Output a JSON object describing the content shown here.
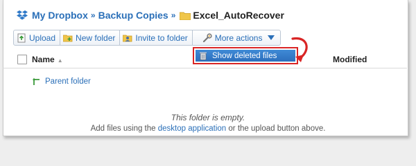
{
  "breadcrumb": {
    "root": "My Dropbox",
    "separator": "»",
    "parent": "Backup Copies",
    "current": "Excel_AutoRecover"
  },
  "toolbar": {
    "upload": "Upload",
    "new_folder": "New folder",
    "invite": "Invite to folder",
    "more_actions": "More actions"
  },
  "dropdown": {
    "show_deleted": "Show deleted files"
  },
  "table": {
    "col_name": "Name",
    "col_modified": "Modified",
    "parent_folder": "Parent folder"
  },
  "empty": {
    "title": "This folder is empty.",
    "sub_before": "Add files using the ",
    "sub_link": "desktop application",
    "sub_after": " or the upload button above."
  },
  "colors": {
    "link": "#2a6fb8",
    "highlight": "#d92525",
    "menu_blue": "#2c6fbd"
  }
}
